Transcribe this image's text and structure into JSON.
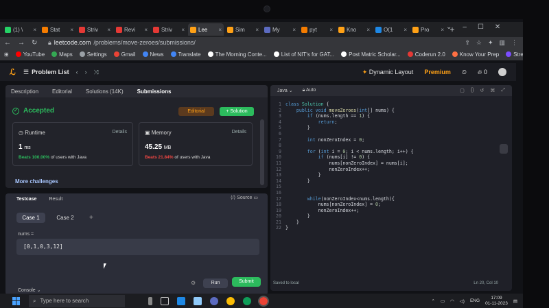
{
  "browser": {
    "tabs": [
      {
        "label": "(1) \\",
        "color": "#25d366"
      },
      {
        "label": "Stat",
        "color": "#f57c00"
      },
      {
        "label": "Striv",
        "color": "#e53935"
      },
      {
        "label": "Revi",
        "color": "#e53935"
      },
      {
        "label": "Striv",
        "color": "#e53935"
      },
      {
        "label": "Lee",
        "color": "#ffa116"
      },
      {
        "label": "Sim",
        "color": "#ffa116"
      },
      {
        "label": "My",
        "color": "#5c6bc0"
      },
      {
        "label": "pyt",
        "color": "#f57c00"
      },
      {
        "label": "Kno",
        "color": "#ffa116"
      },
      {
        "label": "O(1",
        "color": "#1e88e5"
      },
      {
        "label": "Pro",
        "color": "#ffa116"
      }
    ],
    "url_host": "leetcode.com",
    "url_path": "/problems/move-zeroes/submissions/",
    "bookmarks": [
      {
        "label": "YouTube",
        "color": "#ff0000"
      },
      {
        "label": "Maps",
        "color": "#34a853"
      },
      {
        "label": "Settings",
        "color": "#9aa0a6"
      },
      {
        "label": "Gmail",
        "color": "#ea4335"
      },
      {
        "label": "News",
        "color": "#4285f4"
      },
      {
        "label": "Translate",
        "color": "#4285f4"
      },
      {
        "label": "The Morning Conte...",
        "color": "#ffffff"
      },
      {
        "label": "List of NIT's for GAT...",
        "color": "#ffffff"
      },
      {
        "label": "Post Matric Scholar...",
        "color": "#ffffff"
      },
      {
        "label": "Coderun 2.0",
        "color": "#e53935"
      },
      {
        "label": "Know Your Prep",
        "color": "#ff7043"
      },
      {
        "label": "Stream",
        "color": "#7c4dff"
      }
    ]
  },
  "leetcode": {
    "problem_list": "Problem List",
    "dynamic_layout": "Dynamic Layout",
    "premium": "Premium",
    "streak": "0",
    "left_tabs": [
      "Description",
      "Editorial",
      "Solutions (14K)",
      "Submissions"
    ],
    "status": "Accepted",
    "editorial_btn": "Editorial",
    "solution_btn": "+ Solution",
    "runtime": {
      "title": "Runtime",
      "details": "Details",
      "value": "1",
      "unit": "ms",
      "beats_label": "Beats 100.00%",
      "beats_suffix": "of users with Java"
    },
    "memory": {
      "title": "Memory",
      "details": "Details",
      "value": "45.25",
      "unit": "MB",
      "beats_label": "Beats 21.84%",
      "beats_suffix": "of users with Java"
    },
    "more": "More challenges",
    "tc_tabs": [
      "Testcase",
      "Result"
    ],
    "source": "Source",
    "cases": [
      "Case 1",
      "Case 2"
    ],
    "var_label": "nums =",
    "var_value": "[0,1,0,3,12]",
    "console": "Console",
    "run": "Run",
    "submit": "Submit"
  },
  "editor": {
    "language": "Java",
    "auto": "Auto",
    "saved": "Saved to local",
    "cursor_pos": "Ln 20, Col 10"
  },
  "taskbar": {
    "search_placeholder": "Type here to search",
    "lang": "ENG",
    "time": "17:09",
    "date": "01-11-2023"
  }
}
